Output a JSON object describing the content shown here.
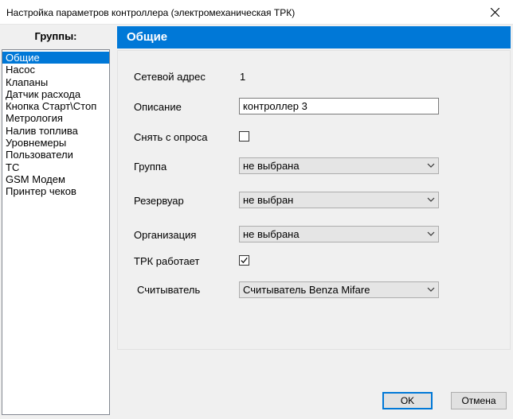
{
  "window": {
    "title": "Настройка параметров контроллера (электромеханическая ТРК)"
  },
  "groups": {
    "header": "Группы:",
    "items": [
      {
        "label": "Общие",
        "selected": true
      },
      {
        "label": "Насос"
      },
      {
        "label": "Клапаны"
      },
      {
        "label": "Датчик расхода"
      },
      {
        "label": "Кнопка Старт\\Стоп"
      },
      {
        "label": "Метрология"
      },
      {
        "label": "Налив топлива"
      },
      {
        "label": "Уровнемеры"
      },
      {
        "label": "Пользователи"
      },
      {
        "label": "ТС"
      },
      {
        "label": "GSM Модем"
      },
      {
        "label": "Принтер чеков"
      }
    ]
  },
  "section": {
    "title": "Общие"
  },
  "form": {
    "network_address_label": "Сетевой адрес",
    "network_address_value": "1",
    "description_label": "Описание",
    "description_value": "контроллер 3",
    "unpoll_label": "Снять с опроса",
    "unpoll_checked": false,
    "group_label": "Группа",
    "group_value": "не выбрана",
    "tank_label": "Резервуар",
    "tank_value": "не выбран",
    "org_label": "Организация",
    "org_value": "не выбрана",
    "trk_works_label": "ТРК работает",
    "trk_works_checked": true,
    "reader_label": "Считыватель",
    "reader_value": "Считыватель Benza Mifare"
  },
  "buttons": {
    "ok": "OK",
    "cancel": "Отмена"
  },
  "colors": {
    "accent": "#0078d7"
  }
}
